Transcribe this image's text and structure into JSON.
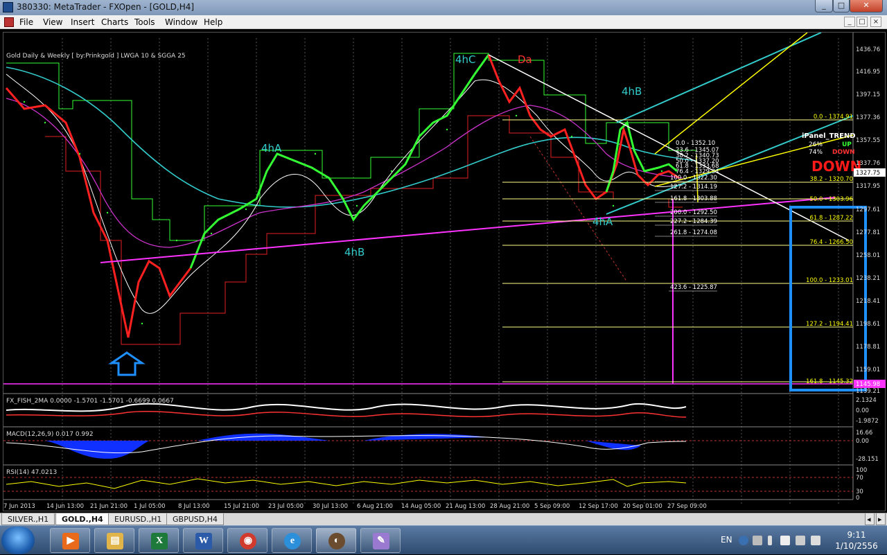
{
  "window": {
    "title": "380330: MetaTrader - FXOpen - [GOLD,H4]",
    "minimize_glyph": "_",
    "maximize_glyph": "□",
    "close_glyph": "✕"
  },
  "menu": {
    "items": [
      "File",
      "View",
      "Insert",
      "Charts",
      "Tools",
      "Window",
      "Help"
    ],
    "doc_controls": [
      "_",
      "□",
      "×"
    ]
  },
  "chart": {
    "header_label": "Gold Daily & Weekly [ by:Prinkgold ] LWGA 10  &  SGGA 25",
    "wave_labels": [
      "4hC",
      "Da",
      "4hA",
      "4hB",
      "4hB",
      "4hA"
    ],
    "price_axis": [
      "1436.76",
      "1416.95",
      "1397.15",
      "1377.36",
      "1357.55",
      "1337.76",
      "1317.95",
      "1297.61",
      "1277.81",
      "1258.01",
      "1238.21",
      "1218.41",
      "1198.61",
      "1178.81",
      "1159.01",
      "1139.21"
    ],
    "current_price": "1327.75",
    "low_marker_price": "1145.98",
    "time_axis": [
      "7 Jun 2013",
      "14 Jun 13:00",
      "21 Jun 21:00",
      "1 Jul 05:00",
      "8 Jul 13:00",
      "15 Jul 21:00",
      "23 Jul 05:00",
      "30 Jul 13:00",
      "6 Aug 21:00",
      "14 Aug 05:00",
      "21 Aug 13:00",
      "28 Aug 21:00",
      "5 Sep 09:00",
      "12 Sep 17:00",
      "20 Sep 01:00",
      "27 Sep 09:00"
    ],
    "fib_right": [
      "0.0 - 1374.91",
      "38.2 - 1320.70",
      "50.0 - 1303.96",
      "61.8 - 1287.22",
      "76.4 - 1266.50",
      "100.0 - 1233.01",
      "127.2 - 1194.41",
      "161.8 - 1145.32"
    ],
    "fib_mid": [
      "0.0 - 1352.10",
      "23.6 - 1345.07",
      "38.2 - 1340.73",
      "50.0 - 1337.20",
      "61.8 - 1333.68",
      "76.4 - 1329.34",
      "100.0 - 1322.30",
      "127.2 - 1314.19",
      "161.8 - 1303.88",
      "200.0 - 1292.50",
      "227.2 - 1284.39",
      "261.8 - 1274.08",
      "423.6 - 1225.87"
    ],
    "ipanel": {
      "title": "iPanel_TREND",
      "pct1": "26%",
      "dir1": "UP",
      "pct2": "74%",
      "dir2": "DOWN",
      "big": "DOWN"
    }
  },
  "indicators": {
    "fisher": {
      "label": "FX_FISH_2MA 0.0000 -1.5701 -1.5701 -0.6699 0.0667",
      "axis": [
        "2.1324",
        "0.00",
        "-1.9872"
      ]
    },
    "macd": {
      "label": "MACD(12,26,9) 0.017 0.992",
      "axis": [
        "16.66",
        "0.00",
        "-28.151"
      ]
    },
    "rsi": {
      "label": "RSI(14) 47.0213",
      "axis": [
        "100",
        "70",
        "30",
        "0"
      ]
    }
  },
  "tabs": [
    {
      "label": "SILVER.,H1",
      "active": false
    },
    {
      "label": "GOLD.,H4",
      "active": true
    },
    {
      "label": "EURUSD.,H1",
      "active": false
    },
    {
      "label": "GBPUSD,H4",
      "active": false
    }
  ],
  "taskbar": {
    "apps": [
      {
        "name": "media-player-icon",
        "glyph": "▶",
        "color": "#e86a1a"
      },
      {
        "name": "folder-icon",
        "glyph": "▤",
        "color": "#e0b448"
      },
      {
        "name": "excel-icon",
        "glyph": "X",
        "color": "#1d7a3a"
      },
      {
        "name": "word-icon",
        "glyph": "W",
        "color": "#2a5aa8"
      },
      {
        "name": "chrome-icon",
        "glyph": "◉",
        "color": "#d13b2e"
      },
      {
        "name": "ie-icon",
        "glyph": "e",
        "color": "#2b8fd9"
      },
      {
        "name": "metatrader-icon",
        "glyph": "◐",
        "color": "#6b4c2e"
      },
      {
        "name": "paint-icon",
        "glyph": "✎",
        "color": "#9a7ad0"
      }
    ],
    "language": "EN",
    "time": "9:11",
    "date": "1/10/2556"
  },
  "colors": {
    "bull_candle": "#33ff33",
    "bear_candle": "#ff2020",
    "ma_cyan": "#33cccc",
    "ma_purple": "#cc33cc",
    "trendline_magenta": "#ff33ff",
    "fib_yellow": "#ffff00",
    "highlight_box": "#1e90ff",
    "wave_label": "#33cccc",
    "wave_label_red": "#ff3333"
  }
}
